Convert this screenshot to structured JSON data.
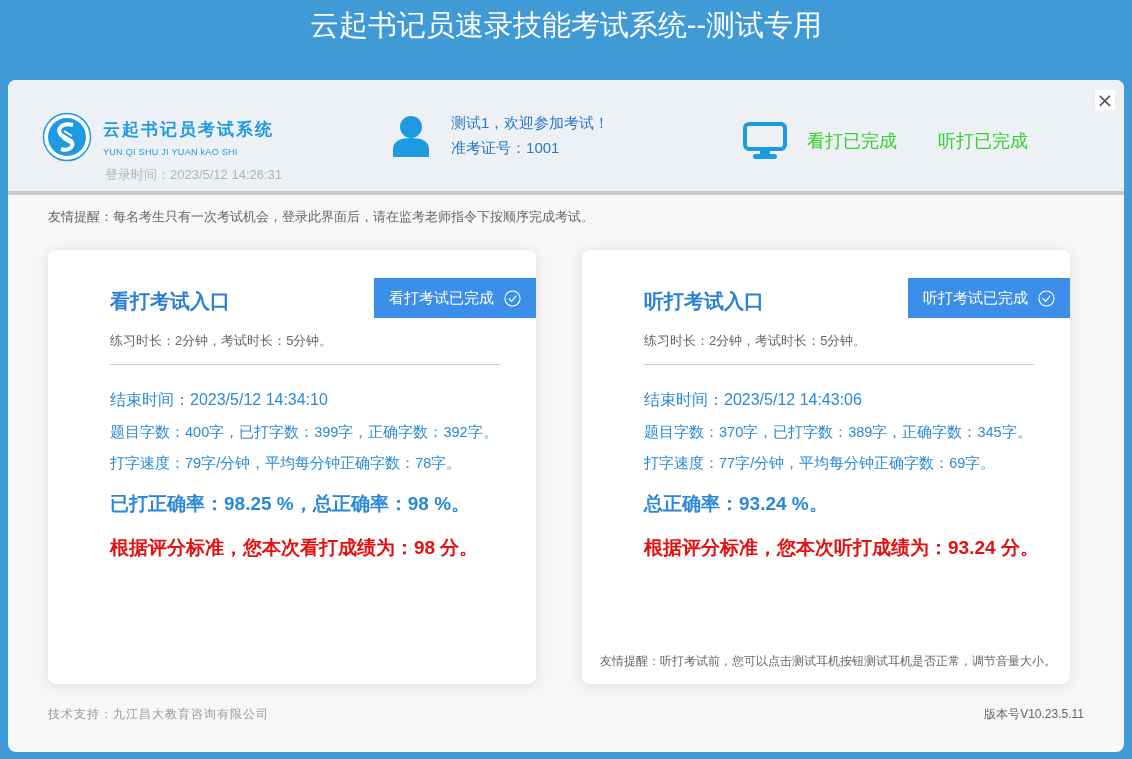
{
  "window": {
    "title": "云起书记员速录技能考试系统--测试专用",
    "close": "×"
  },
  "header": {
    "logo_title": "云起书记员考试系统",
    "logo_subtitle": "YUN QI SHU JI YUAN kAO SHI",
    "login_time": "登录时间：2023/5/12 14:26:31",
    "welcome": "测试1，欢迎参加考试！",
    "exam_id": "准考证号：1001",
    "statuses": [
      {
        "label": "看打已完成",
        "done": true
      },
      {
        "label": "听打已完成",
        "done": true
      }
    ]
  },
  "notice": "友情提醒：每名考生只有一次考试机会，登录此界面后，请在监考老师指令下按顺序完成考试。",
  "exams": [
    {
      "title": "看打考试入口",
      "button": {
        "label": "看打考试已完成",
        "done": true
      },
      "durations": "练习时长：2分钟，考试时长：5分钟。",
      "end_time": "结束时间：2023/5/12 14:34:10",
      "counts": "题目字数：400字，已打字数：399字，正确字数：392字。",
      "speed": "打字速度：79字/分钟，平均每分钟正确字数：78字。",
      "accuracy": "已打正确率：98.25 %，总正确率：98 %。",
      "score": "根据评分标准，您本次看打成绩为：98 分。"
    },
    {
      "title": "听打考试入口",
      "button": {
        "label": "听打考试已完成",
        "done": true
      },
      "durations": "练习时长：2分钟，考试时长：5分钟。",
      "end_time": "结束时间：2023/5/12 14:43:06",
      "counts": "题目字数：370字，已打字数：389字，正确字数：345字。",
      "speed": "打字速度：77字/分钟，平均每分钟正确字数：69字。",
      "accuracy": "总正确率：93.24 %。",
      "score": "根据评分标准，您本次听打成绩为：93.24 分。",
      "tip": "友情提醒：听打考试前，您可以点击测试耳机按钮测试耳机是否正常，调节音量大小。"
    }
  ],
  "footer": {
    "support": "技术支持：九江昌大教育咨询有限公司",
    "version": "版本号V10.23.5.11"
  }
}
